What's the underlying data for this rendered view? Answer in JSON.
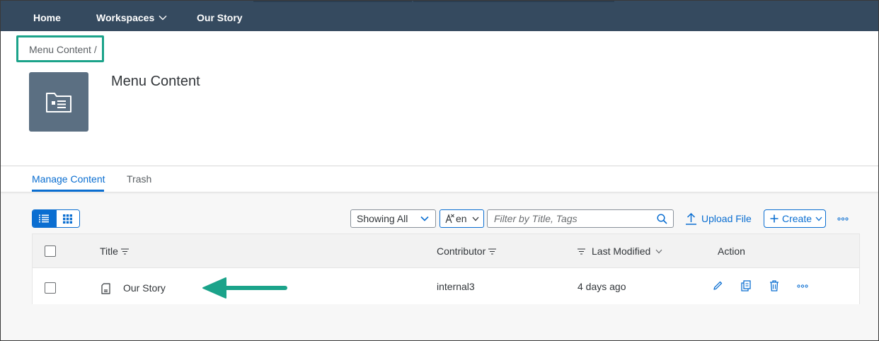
{
  "nav": {
    "home": "Home",
    "workspaces": "Workspaces",
    "our_story": "Our Story"
  },
  "breadcrumb": "Menu Content /",
  "page_title": "Menu Content",
  "tabs": [
    {
      "label": "Manage Content",
      "active": true
    },
    {
      "label": "Trash",
      "active": false
    }
  ],
  "toolbar": {
    "showing_select": "Showing All",
    "language_select": "en",
    "filter_placeholder": "Filter by Title, Tags",
    "upload_label": "Upload File",
    "create_label": "Create"
  },
  "table": {
    "columns": {
      "title": "Title",
      "contributor": "Contributor",
      "last_modified": "Last Modified",
      "action": "Action"
    },
    "rows": [
      {
        "title": "Our Story",
        "contributor": "internal3",
        "last_modified": "4 days ago"
      }
    ]
  },
  "colors": {
    "nav_bg": "#354a5f",
    "accent": "#0a6ed1",
    "highlight": "#1ba38a",
    "folder_tile": "#5b6f82"
  },
  "icons": {
    "folder": "folder-icon",
    "list_view": "list-view-icon",
    "grid_view": "grid-view-icon",
    "upload": "upload-icon",
    "search": "search-icon",
    "document": "document-icon",
    "edit": "pencil-icon",
    "copy": "copy-icon",
    "delete": "trash-icon",
    "more": "overflow-icon"
  }
}
